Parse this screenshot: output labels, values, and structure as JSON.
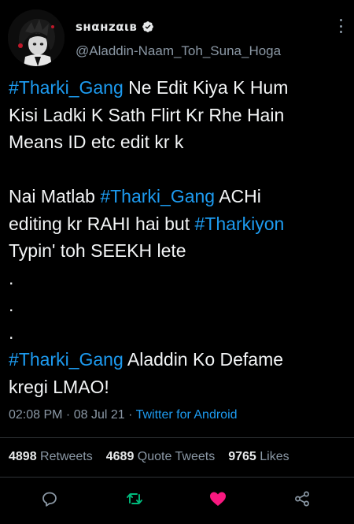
{
  "author": {
    "display_name": "ѕнαнzαιв",
    "handle": "@Aladdin-Naam_Toh_Suna_Hoga"
  },
  "tweet": {
    "lines": [
      {
        "parts": [
          {
            "t": "#Tharki_Gang",
            "tag": true
          },
          {
            "t": " Ne Edit Kiya K Hum"
          }
        ]
      },
      {
        "parts": [
          {
            "t": "Kisi Ladki K Sath Flirt Kr Rhe Hain"
          }
        ]
      },
      {
        "parts": [
          {
            "t": "Means ID etc edit kr k"
          }
        ]
      },
      {
        "parts": []
      },
      {
        "parts": [
          {
            "t": "Nai Matlab "
          },
          {
            "t": "#Tharki_Gang",
            "tag": true
          },
          {
            "t": " ACHi"
          }
        ]
      },
      {
        "parts": [
          {
            "t": "editing kr RAHI hai but "
          },
          {
            "t": "#Tharkiyon",
            "tag": true
          }
        ]
      },
      {
        "parts": [
          {
            "t": "Typin' toh SEEKH lete"
          }
        ]
      },
      {
        "parts": [
          {
            "t": "."
          }
        ]
      },
      {
        "parts": [
          {
            "t": "."
          }
        ]
      },
      {
        "parts": [
          {
            "t": "."
          }
        ]
      },
      {
        "parts": [
          {
            "t": "#Tharki_Gang",
            "tag": true
          },
          {
            "t": " Aladdin Ko Defame"
          }
        ]
      },
      {
        "parts": [
          {
            "t": "kregi LMAO!"
          }
        ]
      }
    ]
  },
  "meta": {
    "time": "02:08 PM",
    "date": "08 Jul 21",
    "separator": " · ",
    "source": "Twitter for Android"
  },
  "stats": {
    "retweets_count": "4898",
    "retweets_label": "Retweets",
    "quotes_count": "4689",
    "quotes_label": "Quote Tweets",
    "likes_count": "9765",
    "likes_label": "Likes"
  },
  "icons": {
    "reply": "reply-icon",
    "retweet": "retweet-icon",
    "like": "heart-icon",
    "share": "share-icon",
    "verified": "verified-badge-icon",
    "more": "more-vertical-icon"
  },
  "colors": {
    "background": "#000000",
    "hashtag": "#1d9bf0",
    "secondary_text": "#8b98a5",
    "retweet_active": "#00ba7c",
    "like_active": "#f91880"
  }
}
